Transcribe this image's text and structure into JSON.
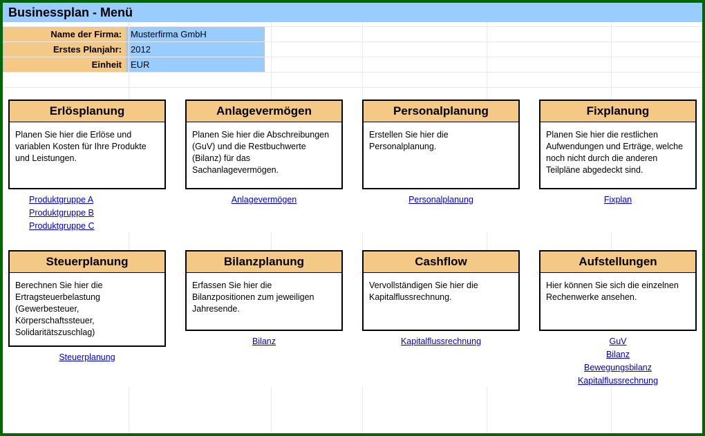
{
  "header": {
    "title": "Businessplan - Menü"
  },
  "info": {
    "firm_label": "Name der Firma:",
    "firm_value": "Musterfirma GmbH",
    "year_label": "Erstes Planjahr:",
    "year_value": "2012",
    "unit_label": "Einheit",
    "unit_value": "EUR"
  },
  "cards_row1": [
    {
      "title": "Erlösplanung",
      "desc": "Planen Sie hier die Erlöse und variablen Kosten für Ihre Produkte und Leistungen.",
      "links": [
        "Produktgruppe A",
        "Produktgruppe B",
        "Produktgruppe C"
      ]
    },
    {
      "title": "Anlagevermögen",
      "desc": "Planen Sie hier die Abschreibungen (GuV) und die Restbuchwerte (Bilanz) für das Sachanlagevermögen.",
      "links": [
        "Anlagevermögen"
      ]
    },
    {
      "title": "Personalplanung",
      "desc": "Erstellen Sie hier die Personalplanung.",
      "links": [
        "Personalplanung"
      ]
    },
    {
      "title": "Fixplanung",
      "desc": "Planen Sie hier die restlichen Aufwendungen und Erträge, welche noch nicht durch die anderen Teilpläne abgedeckt sind.",
      "links": [
        "Fixplan"
      ]
    }
  ],
  "cards_row2": [
    {
      "title": "Steuerplanung",
      "desc": "Berechnen Sie hier die Ertragsteuerbelastung (Gewerbesteuer, Körperschaftssteuer, Solidaritätszuschlag)",
      "links": [
        "Steuerplanung"
      ]
    },
    {
      "title": "Bilanzplanung",
      "desc": "Erfassen Sie hier die Bilanzpositionen zum jeweiligen Jahresende.",
      "links": [
        "Bilanz"
      ]
    },
    {
      "title": "Cashflow",
      "desc": "Vervollständigen Sie hier die Kapitalflussrechnung.",
      "links": [
        "Kapitalflussrechnung"
      ]
    },
    {
      "title": "Aufstellungen",
      "desc": "Hier können Sie sich die einzelnen Rechenwerke ansehen.",
      "links": [
        "GuV",
        "Bilanz",
        "Bewegungsbilanz",
        "Kapitalflussrechnung"
      ]
    }
  ]
}
